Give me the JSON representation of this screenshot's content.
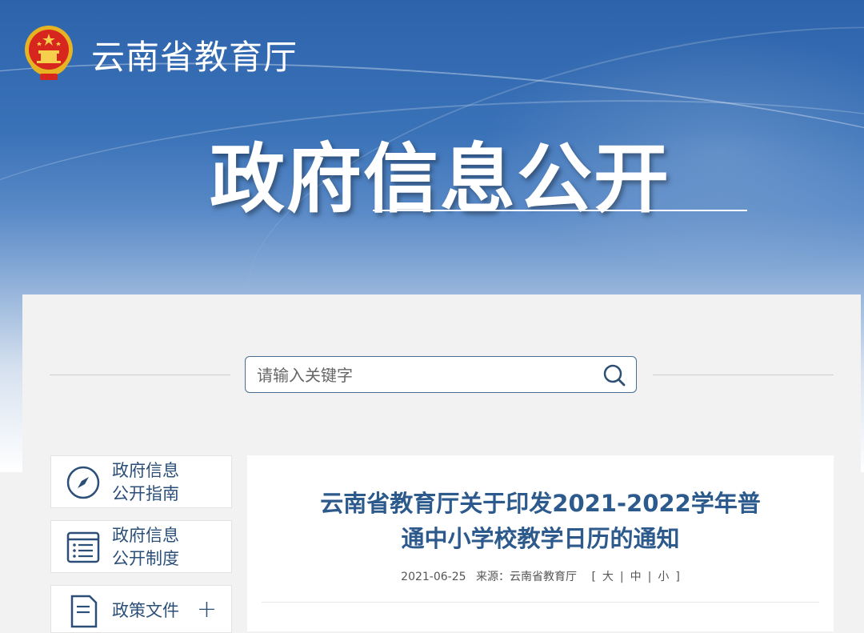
{
  "header": {
    "site_name": "云南省教育厅",
    "banner_title": "政府信息公开"
  },
  "search": {
    "placeholder": "请输入关键字"
  },
  "sidebar": {
    "items": [
      {
        "line1": "政府信息",
        "line2": "公开指南",
        "icon": "compass-icon"
      },
      {
        "line1": "政府信息",
        "line2": "公开制度",
        "icon": "list-document-icon"
      },
      {
        "line1": "政策文件",
        "line2": "",
        "icon": "document-icon",
        "expand": "+"
      }
    ]
  },
  "article": {
    "title_line1": "云南省教育厅关于印发2021-2022学年普",
    "title_line2": "通中小学校教学日历的通知",
    "date": "2021-06-25",
    "source_label": "来源：云南省教育厅",
    "font_size_open": "[",
    "font_large": "大",
    "sep": "|",
    "font_medium": "中",
    "font_small": "小",
    "font_size_close": "]"
  },
  "colors": {
    "brand_blue": "#2d63ab",
    "title_blue": "#2d5a8c",
    "nav_text": "#2b4f78"
  }
}
